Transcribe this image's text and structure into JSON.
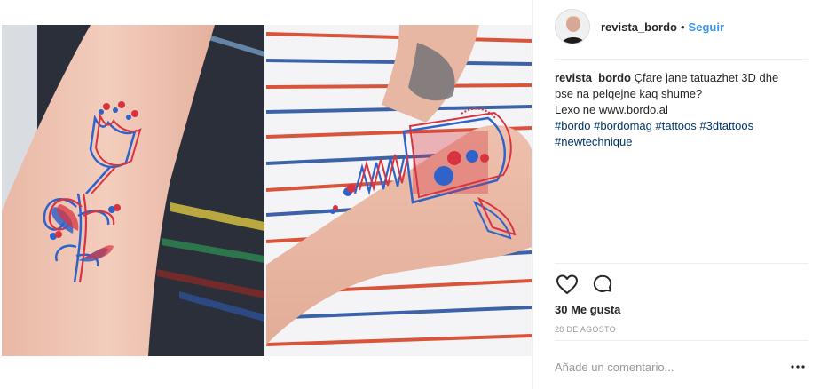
{
  "header": {
    "username": "revista_bordo",
    "separator": "•",
    "follow_label": "Seguir"
  },
  "caption": {
    "username": "revista_bordo",
    "text_line1": "Çfare jane tatuazhet 3D dhe",
    "text_line2": "pse na pelqejne kaq shume?",
    "text_line3": "Lexo ne www.bordo.al",
    "tags_line1": [
      "#bordo",
      "#bordomag",
      "#tattoos",
      "#3dtattoos"
    ],
    "tags_line2": [
      "#newtechnique"
    ]
  },
  "actions": {
    "like_icon": "heart-icon",
    "comment_icon": "comment-icon"
  },
  "likes_label": "30 Me gusta",
  "date_label": "28 DE AGOSTO",
  "comment": {
    "placeholder": "Añade un comentario...",
    "more_icon": "more-options-icon"
  },
  "colors": {
    "accent_blue": "#3897f0",
    "hashtag_blue": "#003569",
    "text": "#262626",
    "muted": "#999999",
    "divider": "#efefef",
    "tattoo_red": "#d8343f",
    "tattoo_blue": "#2f63c9"
  }
}
